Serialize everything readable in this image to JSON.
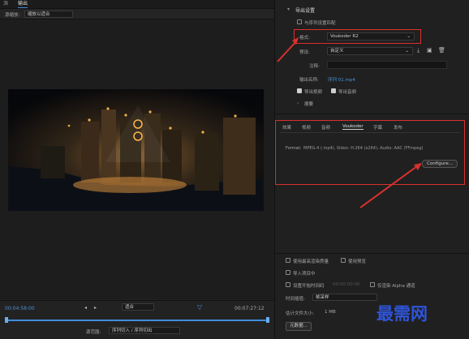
{
  "left_panel": {
    "tabs": [
      "源",
      "输出"
    ],
    "source_scaling_label": "源缩放:",
    "source_scaling_value": "缩放以适合",
    "timecode_start": "00:04:58:00",
    "timecode_end": "00:07:27:12",
    "fit_value": "适合",
    "source_range_label": "源范围:",
    "source_range_value": "序列切入 / 序列切出"
  },
  "export_settings": {
    "section_title": "导出设置",
    "match_sequence_label": "与序列设置匹配",
    "format_label": "格式:",
    "format_value": "Voukoder R2",
    "preset_label": "预设:",
    "preset_value": "自定义",
    "comments_label": "注释:",
    "output_name_label": "输出名称:",
    "output_name_value": "序列 01.mp4",
    "export_video_label": "导出视频",
    "export_audio_label": "导出音频",
    "summary_label": "摘要"
  },
  "tabs_panel": {
    "tabs": [
      "效果",
      "视频",
      "音频",
      "Voukoder",
      "字幕",
      "发布"
    ],
    "active_tab": "Voukoder",
    "format_label": "Format:",
    "format_value": "MPEG-4 (.mp4), Video: H.264 (x264), Audio: AAC (FFmpeg)",
    "configure_label": "Configure..."
  },
  "bottom_options": {
    "max_render_quality": "使用最高渲染质量",
    "use_previews": "使用预览",
    "import_into_project": "导入项目中",
    "set_start_timecode": "设置开始时间码",
    "start_timecode_value": "00:00:00:00",
    "render_alpha": "仅渲染 Alpha 通道",
    "time_interpolation_label": "时间插值:",
    "time_interpolation_value": "帧采样",
    "estimated_file_size_label": "估计文件大小:",
    "estimated_file_size_value": "1 MB",
    "metadata_button": "元数据..."
  },
  "watermark": "最需网",
  "colors": {
    "accent": "#3f8edb",
    "highlight_red": "#d8312c",
    "watermark_blue": "#2f54d6"
  }
}
